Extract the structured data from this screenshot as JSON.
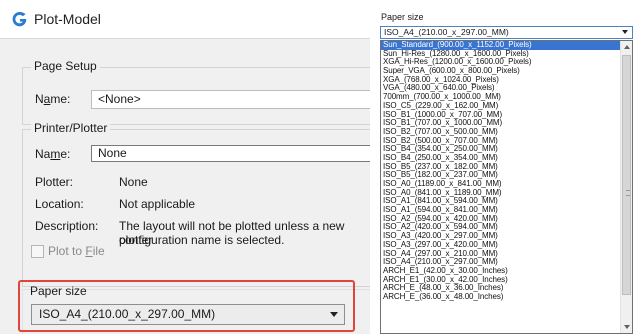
{
  "window": {
    "title": "Plot-Model"
  },
  "page_setup": {
    "group_title": "Page Setup",
    "name_label_prefix": "N",
    "name_label_underlined": "a",
    "name_label_suffix": "me:",
    "name_value": "<None>"
  },
  "printer": {
    "group_title": "Printer/Plotter",
    "name_label_prefix": "Na",
    "name_label_underlined": "m",
    "name_label_suffix": "e:",
    "name_value": "None",
    "plotter_label": "Plotter:",
    "plotter_value": "None",
    "location_label": "Location:",
    "location_value": "Not applicable",
    "description_label": "Description:",
    "description_line1": "The layout will not be plotted unless a new plotter",
    "description_line2": "configuration name is selected.",
    "plot_to_file_prefix": "Plot to ",
    "plot_to_file_underlined": "F",
    "plot_to_file_suffix": "ile"
  },
  "paper_size": {
    "label": "Paper size",
    "value": "ISO_A4_(210.00_x_297.00_MM)"
  },
  "dropdown": {
    "label": "Paper size",
    "current": "ISO_A4_(210.00_x_297.00_MM)",
    "selected_index": 0,
    "options": [
      "Sun_Standard_(900.00_x_1152.00_Pixels)",
      "Sun_Hi-Res_(1280.00_x_1600.00_Pixels)",
      "XGA_Hi-Res_(1200.00_x_1600.00_Pixels)",
      "Super_VGA_(600.00_x_800.00_Pixels)",
      "XGA_(768.00_x_1024.00_Pixels)",
      "VGA_(480.00_x_640.00_Pixels)",
      "700mm_(700.00_x_1000.00_MM)",
      "ISO_C5_(229.00_x_162.00_MM)",
      "ISO_B1_(1000.00_x_707.00_MM)",
      "ISO_B1_(707.00_x_1000.00_MM)",
      "ISO_B2_(707.00_x_500.00_MM)",
      "ISO_B2_(500.00_x_707.00_MM)",
      "ISO_B4_(354.00_x_250.00_MM)",
      "ISO_B4_(250.00_x_354.00_MM)",
      "ISO_B5_(237.00_x_182.00_MM)",
      "ISO_B5_(182.00_x_237.00_MM)",
      "ISO_A0_(1189.00_x_841.00_MM)",
      "ISO_A0_(841.00_x_1189.00_MM)",
      "ISO_A1_(841.00_x_594.00_MM)",
      "ISO_A1_(594.00_x_841.00_MM)",
      "ISO_A2_(594.00_x_420.00_MM)",
      "ISO_A2_(420.00_x_594.00_MM)",
      "ISO_A3_(420.00_x_297.00_MM)",
      "ISO_A3_(297.00_x_420.00_MM)",
      "ISO_A4_(297.00_x_210.00_MM)",
      "ISO_A4_(210.00_x_297.00_MM)",
      "ARCH_E1_(42.00_x_30.00_Inches)",
      "ARCH_E1_(30.00_x_42.00_Inches)",
      "ARCH_E_(48.00_x_36.00_Inches)",
      "ARCH_E_(36.00_x_48.00_Inches)"
    ]
  },
  "colors": {
    "highlight_border": "#e0443a",
    "selection": "#3874d0",
    "app_icon": "#2b7cd3"
  },
  "icons": {
    "app": "app-g-logo-icon"
  }
}
